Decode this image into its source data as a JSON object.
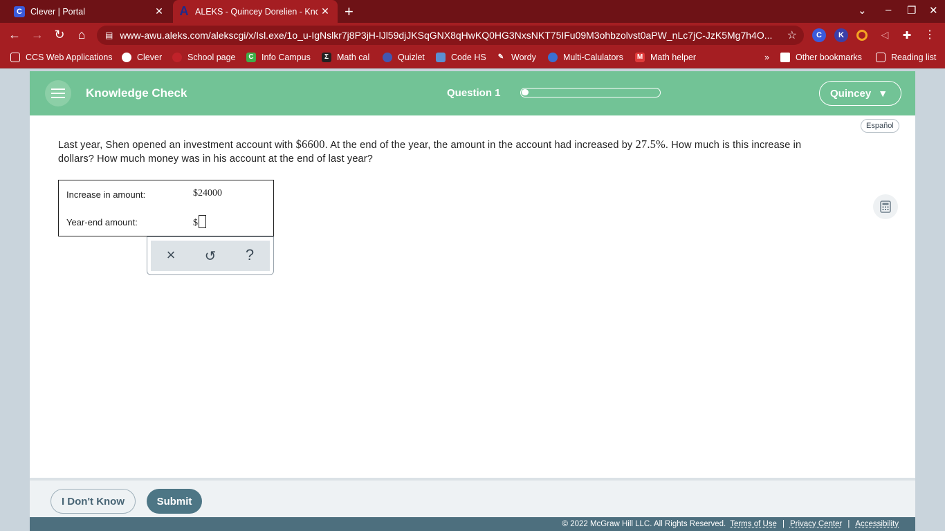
{
  "browser": {
    "tabs": [
      {
        "title": "Clever | Portal",
        "icon": "C"
      },
      {
        "title": "ALEKS - Quincey Dorelien - Know",
        "icon": "A"
      }
    ],
    "url": "www-awu.aleks.com/alekscgi/x/Isl.exe/1o_u-IgNslkr7j8P3jH-lJl59djJKSqGNX8qHwKQ0HG3NxsNKT75IFu09M3ohbzolvst0aPW_nLc7jC-JzK5Mg7h4O...",
    "extensions": [
      "C",
      "K"
    ],
    "bookmarks": [
      "CCS Web Applications",
      "Clever",
      "School page",
      "Info Campus",
      "Math cal",
      "Quizlet",
      "Code HS",
      "Wordy",
      "Multi-Calulators",
      "Math helper"
    ],
    "bookmark_icons": [
      "",
      "",
      "",
      "C",
      "",
      "",
      "",
      "",
      "",
      "M"
    ],
    "other_bookmarks": "Other bookmarks",
    "reading_list": "Reading list",
    "accent_color": "#a51e22"
  },
  "header": {
    "title": "Knowledge Check",
    "question_label": "Question 1",
    "progress": 0.05,
    "user_name": "Quincey",
    "accent_color": "#72c396"
  },
  "language_toggle": "Español",
  "question": {
    "part1": "Last year, Shen opened an investment account with ",
    "amount": "$6600",
    "part2": ". At the end of the year, the amount in the account had increased by ",
    "percent": "27.5%",
    "part3": ". How much is this increase in dollars? How much money was in his account at the end of last year?"
  },
  "answers": {
    "increase_label": "Increase in amount:",
    "increase_value": "$24000",
    "yearend_label": "Year-end amount:",
    "yearend_prefix": "$"
  },
  "tools": {
    "clear": "×",
    "undo": "↺",
    "help": "?"
  },
  "footer": {
    "idk_label": "I Don't Know",
    "submit_label": "Submit",
    "copyright": "© 2022 McGraw Hill LLC. All Rights Reserved.",
    "links": [
      "Terms of Use",
      "Privacy Center",
      "Accessibility"
    ]
  }
}
